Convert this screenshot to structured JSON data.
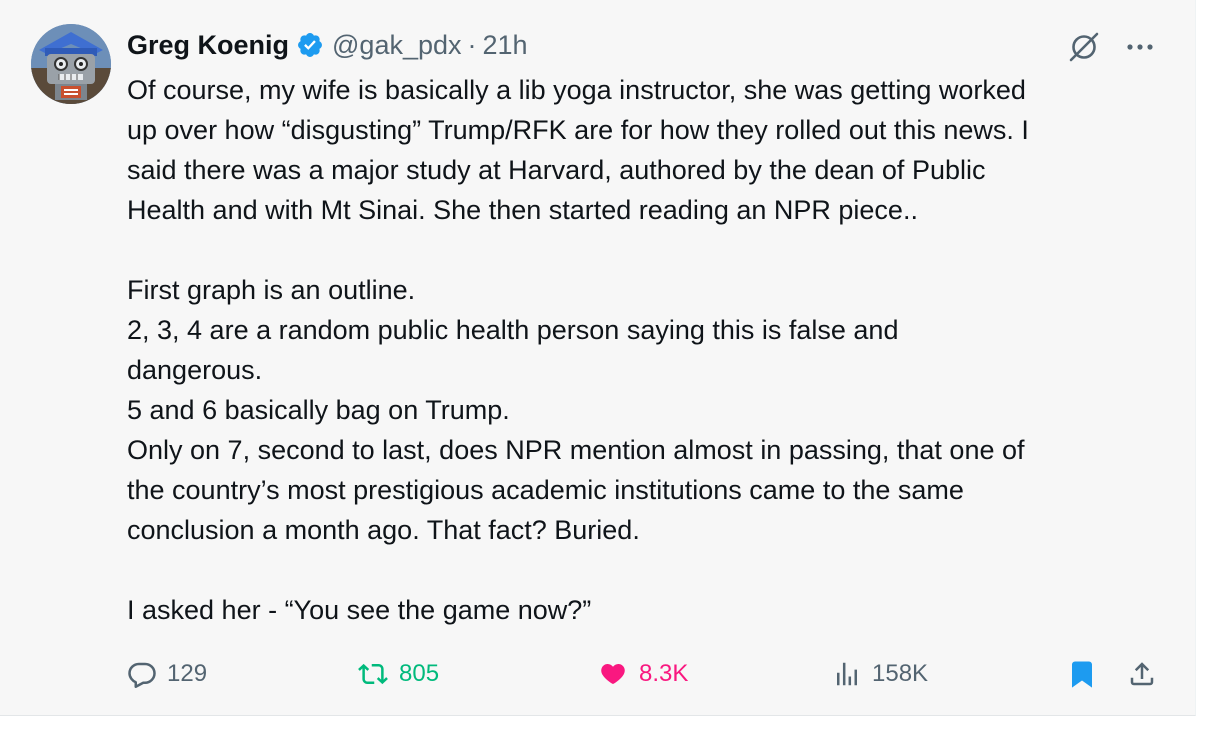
{
  "tweet": {
    "author": {
      "name": "Greg Koenig",
      "handle": "@gak_pdx",
      "verified": true
    },
    "separator": "·",
    "time": "21h",
    "paragraphs": [
      [
        "Of course, my wife is basically a lib yoga instructor, she was getting worked",
        "up over how “disgusting” Trump/RFK are for how they rolled out this news. I",
        "said there was a major study at Harvard, authored by the dean of Public",
        "Health and with Mt Sinai. She then started reading an NPR piece.."
      ],
      [
        "First graph is an outline.",
        "2, 3, 4 are a random public health person saying this is false and",
        "dangerous.",
        "5 and 6 basically bag on Trump.",
        "Only on 7, second to last, does NPR mention almost in passing, that one of",
        "the country’s most prestigious academic institutions came to the same",
        "conclusion a month ago. That fact? Buried."
      ],
      [
        "I asked her - “You see the game now?”"
      ]
    ],
    "stats": {
      "replies": "129",
      "reposts": "805",
      "likes": "8.3K",
      "views": "158K"
    },
    "liked": true,
    "reposted": true,
    "bookmarked": true
  },
  "icons": {
    "reply": "reply-icon",
    "repost": "repost-icon",
    "like": "heart-icon",
    "views": "views-icon",
    "bookmark": "bookmark-icon",
    "share": "share-icon",
    "grok": "grok-icon",
    "more": "more-icon",
    "verified": "verified-badge-icon"
  },
  "colors": {
    "background": "#f7f7f7",
    "text": "#0f1419",
    "muted": "#536471",
    "verified": "#1d9bf0",
    "repost": "#00ba7c",
    "like": "#f91880",
    "bookmark": "#1d9bf0"
  }
}
